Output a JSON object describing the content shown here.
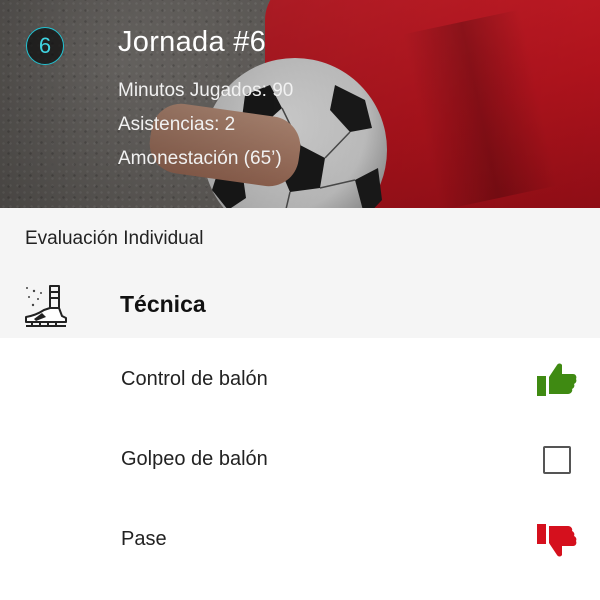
{
  "match": {
    "round_number": "6",
    "title": "Jornada #6",
    "stats": {
      "minutes": "Minutos Jugados: 90",
      "assists": "Asistencias: 2",
      "cards": "Amonestación (65’)"
    }
  },
  "evaluation": {
    "section_title": "Evaluación Individual",
    "category": {
      "icon": "football-boot-icon",
      "title": "Técnica"
    },
    "skills": [
      {
        "label": "Control de balón",
        "rating": "thumbs-up",
        "icon": "thumbs-up-icon",
        "color": "#3f8a12"
      },
      {
        "label": "Golpeo de balón",
        "rating": "unrated",
        "icon": "checkbox-icon",
        "color": "#555555"
      },
      {
        "label": "Pase",
        "rating": "thumbs-down",
        "icon": "thumbs-down-icon",
        "color": "#d5101d"
      }
    ]
  },
  "colors": {
    "badge_accent": "#1fc2d2",
    "positive": "#3f8a12",
    "negative": "#d5101d"
  }
}
